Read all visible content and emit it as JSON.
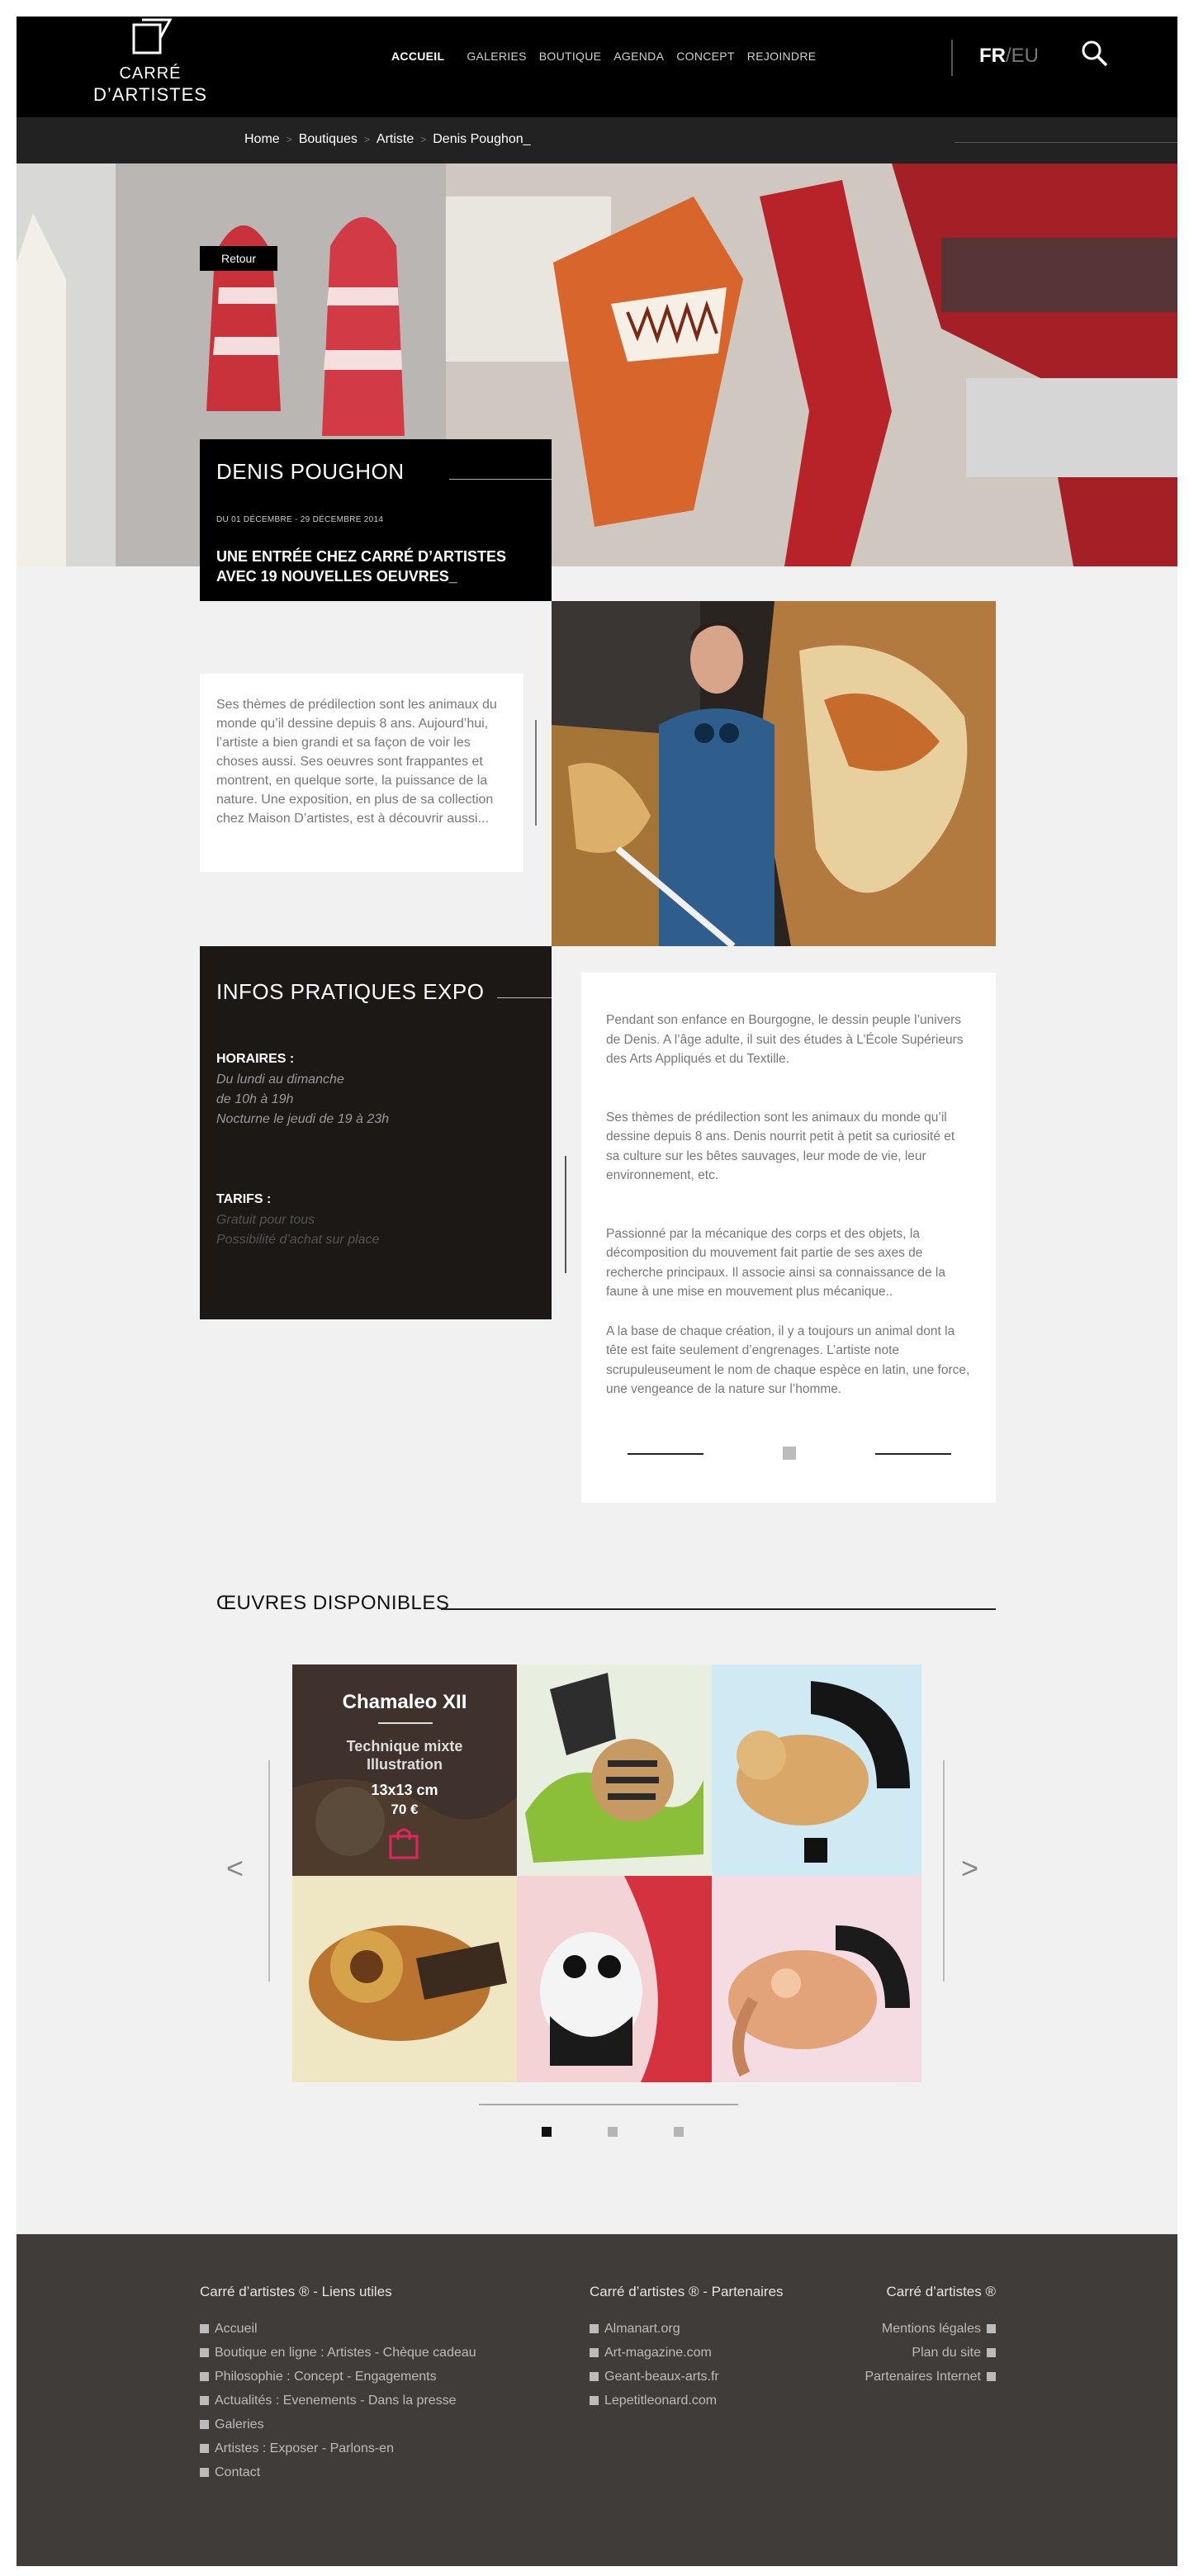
{
  "brand": {
    "logo_line1": "CARRÉ",
    "logo_line2": "D’ARTISTES"
  },
  "nav": {
    "items": [
      "ACCUEIL",
      "GALERIES",
      "BOUTIQUE",
      "AGENDA",
      "CONCEPT",
      "REJOINDRE"
    ],
    "active": "ACCUEIL",
    "lang_active": "FR",
    "lang_separator": "/",
    "lang_other": "EU"
  },
  "breadcrumb": {
    "items": [
      "Home",
      "Boutiques",
      "Artiste",
      "Denis Poughon_"
    ],
    "separator": ">"
  },
  "hero": {
    "back_label": "Retour",
    "artist": "DENIS POUGHON",
    "dates": "DU 01 DÉCEMBRE - 29 DÉCEMBRE 2014",
    "headline": "UNE ENTRÉE CHEZ CARRÉ D’ARTISTES AVEC 19 NOUVELLES OEUVRES_"
  },
  "intro": {
    "text": "Ses thèmes de prédilection sont les animaux du monde qu’il dessine depuis 8 ans. Aujourd’hui, l’artiste a bien grandi et sa façon de voir les choses aussi. Ses oeuvres sont frappantes et montrent, en quelque sorte, la puissance de la nature. Une exposition, en plus de sa collection chez Maison D’artistes, est à découvrir aussi..."
  },
  "infos": {
    "title": "INFOS PRATIQUES EXPO",
    "hours_label": "HORAIRES :",
    "hours_1": "Du lundi au dimanche",
    "hours_2": "de 10h à 19h",
    "hours_3": "Nocturne le jeudi de 19 à 23h",
    "tarifs_label": "TARIFS :",
    "tarifs_1": "Gratuit pour tous",
    "tarifs_2": "Possibilité d’achat sur place"
  },
  "bio": {
    "p1": "Pendant son enfance en Bourgogne, le dessin peuple l’univers de Denis. A l’âge adulte, il suit des études à L’École Supérieurs des Arts Appliqués et du Textille.",
    "p2": "Ses thèmes de prédilection sont les animaux du monde qu’il dessine depuis 8 ans. Denis nourrit petit à petit sa curiosité et sa culture sur les bêtes sauvages, leur mode de vie, leur environnement, etc.",
    "p3": "Passionné par la mécanique des corps et des objets, la décomposition du mouvement fait partie de ses axes de recherche principaux. Il associe ainsi sa connaissance de la faune à une mise en mouvement plus mécanique..",
    "p4": "A la base de chaque création, il y a toujours un animal dont la tête est faite seulement d’engrenages. L’artiste note scrupuleuseument le nom de chaque espèce en latin, une force, une vengeance de la nature sur l’homme."
  },
  "oeuvres": {
    "title": "ŒUVRES DISPONIBLES",
    "prev": "<",
    "next": ">",
    "featured": {
      "title": "Chamaleo XII",
      "technique_1": "Technique mixte",
      "technique_2": "Illustration",
      "size": "13x13 cm",
      "price": "70 €"
    },
    "active_page": 1,
    "page_count": 3
  },
  "footer": {
    "col1_title": "Carré d’artistes ® - Liens utiles",
    "col1_links": [
      "Accueil",
      "Boutique en ligne : Artistes - Chèque cadeau",
      "Philosophie : Concept - Engagements",
      "Actualités : Evenements - Dans la presse",
      "Galeries",
      "Artistes : Exposer - Parlons-en",
      "Contact"
    ],
    "col2_title": "Carré d’artistes ® - Partenaires",
    "col2_links": [
      "Almanart.org",
      "Art-magazine.com",
      "Geant-beaux-arts.fr",
      "Lepetitleonard.com"
    ],
    "col3_title": "Carré d’artistes ®",
    "col3_links": [
      "Mentions légales",
      "Plan du site",
      "Partenaires Internet"
    ]
  },
  "colors": {
    "header_bg": "#000000",
    "footer_bg": "#403c39",
    "accent_pink": "#e0245e"
  }
}
